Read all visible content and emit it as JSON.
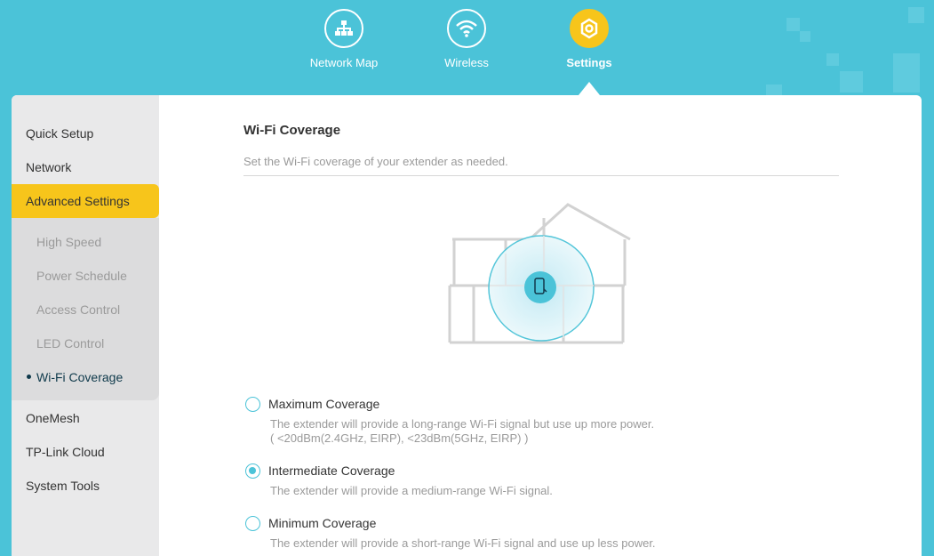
{
  "nav": [
    {
      "label": "Network Map",
      "icon": "network-map-icon",
      "active": false
    },
    {
      "label": "Wireless",
      "icon": "wifi-icon",
      "active": false
    },
    {
      "label": "Settings",
      "icon": "settings-gear-icon",
      "active": true
    }
  ],
  "sidebar": {
    "items": [
      {
        "label": "Quick Setup"
      },
      {
        "label": "Network"
      },
      {
        "label": "Advanced Settings",
        "active": true
      },
      {
        "label": "OneMesh"
      },
      {
        "label": "TP-Link Cloud"
      },
      {
        "label": "System Tools"
      }
    ],
    "sub_items": [
      {
        "label": "High Speed"
      },
      {
        "label": "Power Schedule"
      },
      {
        "label": "Access Control"
      },
      {
        "label": "LED Control"
      },
      {
        "label": "Wi-Fi Coverage",
        "active": true
      }
    ]
  },
  "main": {
    "title": "Wi-Fi Coverage",
    "description": "Set the Wi-Fi coverage of your extender as needed.",
    "options": [
      {
        "label": "Maximum Coverage",
        "desc_line1": "The extender will provide a long-range Wi-Fi signal but use up more power.",
        "desc_line2": "( <20dBm(2.4GHz, EIRP), <23dBm(5GHz, EIRP) )",
        "checked": false
      },
      {
        "label": "Intermediate Coverage",
        "desc_line1": "The extender will provide a medium-range Wi-Fi signal.",
        "checked": true
      },
      {
        "label": "Minimum Coverage",
        "desc_line1": "The extender will provide a short-range Wi-Fi signal and use up less power.",
        "checked": false
      }
    ]
  },
  "colors": {
    "header_bg": "#4bc3d8",
    "accent_yellow": "#f7c51b",
    "accent_teal": "#4bc3d8",
    "sidebar_bg": "#e9e9ea"
  }
}
